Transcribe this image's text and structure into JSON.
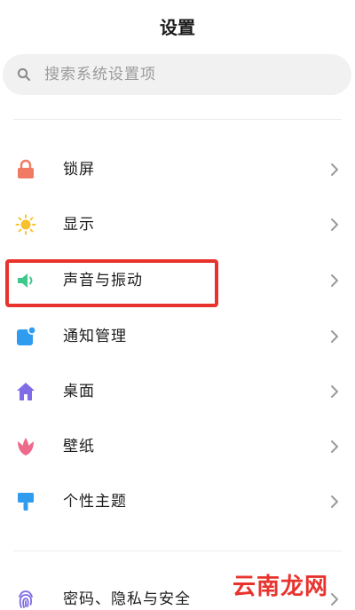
{
  "header": {
    "title": "设置"
  },
  "search": {
    "placeholder": "搜索系统设置项",
    "icon": "search-icon"
  },
  "menu": {
    "items": [
      {
        "label": "锁屏",
        "icon": "lock-icon",
        "color": "#f07a63"
      },
      {
        "label": "显示",
        "icon": "sun-icon",
        "color": "#f7c12e"
      },
      {
        "label": "声音与振动",
        "icon": "speaker-icon",
        "color": "#3ec98c",
        "highlighted": true
      },
      {
        "label": "通知管理",
        "icon": "notification-icon",
        "color": "#2f9cf0"
      },
      {
        "label": "桌面",
        "icon": "home-icon",
        "color": "#7f6ce6"
      },
      {
        "label": "壁纸",
        "icon": "tulip-icon",
        "color": "#ee6a8b"
      },
      {
        "label": "个性主题",
        "icon": "paintbrush-icon",
        "color": "#2f9cf0"
      },
      {
        "label": "密码、隐私与安全",
        "icon": "fingerprint-icon",
        "color": "#7f6ce6"
      }
    ]
  },
  "annotation": {
    "highlight_color": "#e8332d"
  },
  "watermark": {
    "text": "云南龙网",
    "color": "#e8332d"
  }
}
